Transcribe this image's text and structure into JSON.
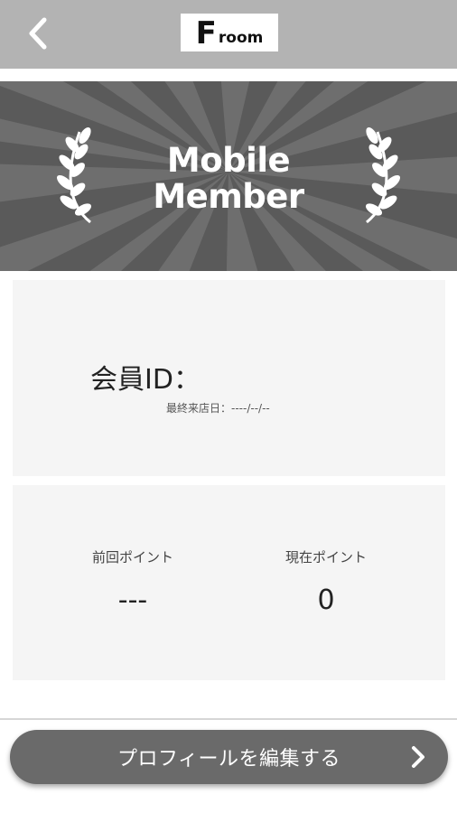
{
  "header": {
    "back_icon": "chevron-left-icon",
    "logo_letter": "F",
    "logo_text": "room",
    "background": "#b3b3b3"
  },
  "banner": {
    "title_line1": "Mobile",
    "title_line2": "Member",
    "background": "#5a5a5a",
    "icons": [
      "laurel-left-icon",
      "laurel-right-icon"
    ]
  },
  "member": {
    "id_label": "会員ID：",
    "last_visit": "最終来店日：----/--/--"
  },
  "points": {
    "previous_label": "前回ポイント",
    "previous_value": "---",
    "current_label": "現在ポイント",
    "current_value": "0"
  },
  "actions": {
    "edit_profile_label": "プロフィールを編集する",
    "edit_profile_icon": "chevron-right-icon",
    "button_color": "#6a6a6a"
  }
}
